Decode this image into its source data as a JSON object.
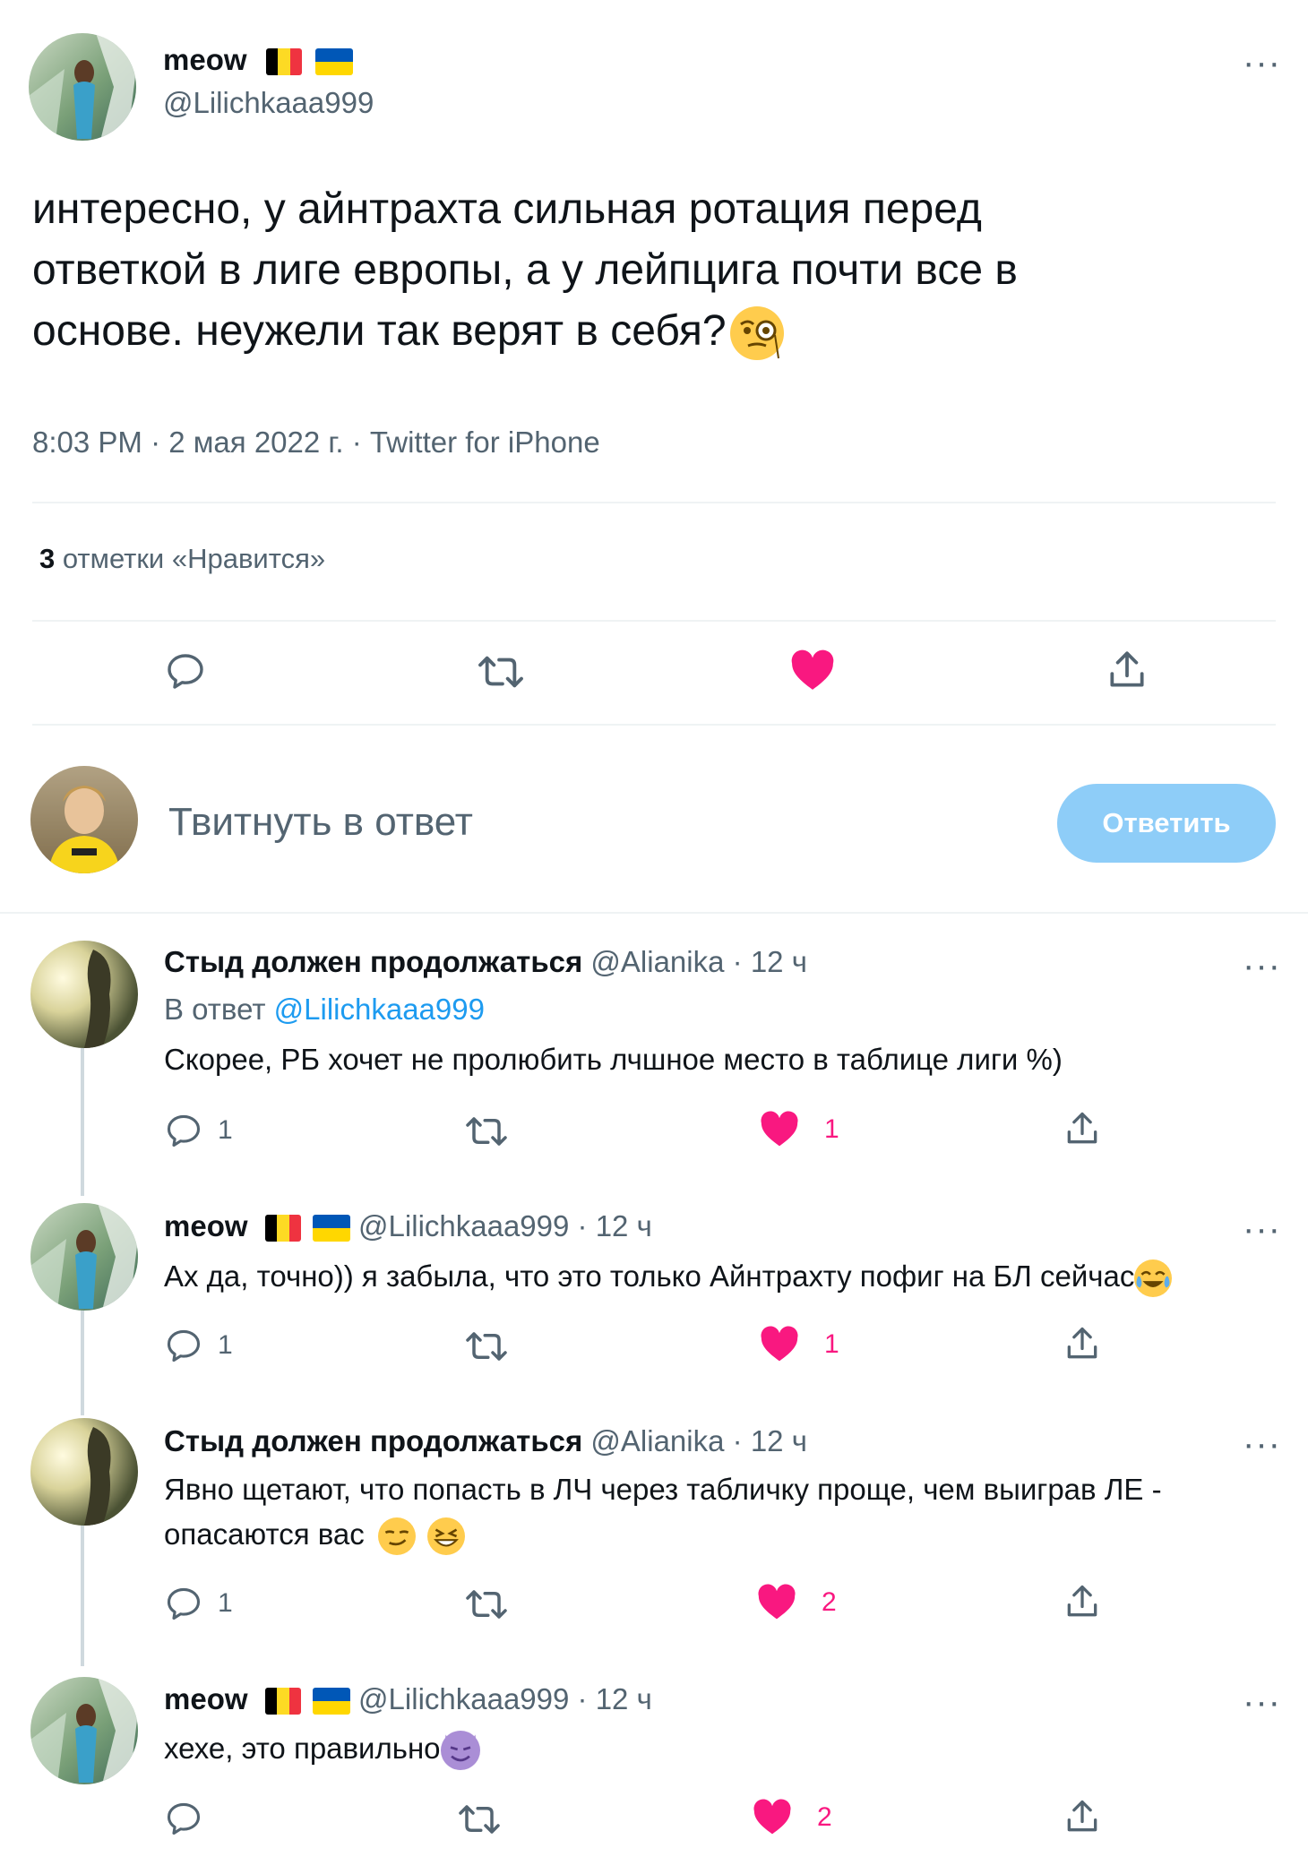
{
  "tweet": {
    "display_name": "meow",
    "handle": "@Lilichkaaa999",
    "text_lines": [
      "интересно, у айнтрахта сильная ротация перед",
      "ответкой в лиге европы, а у лейпцига почти все в",
      "основе. неужели так верят в себя?"
    ],
    "text_emoji": "face-with-monocle",
    "meta": "8:03 PM · 2 мая 2022 г. · Twitter for iPhone",
    "likes_count": "3",
    "likes_label": "отметки «Нравится»"
  },
  "compose": {
    "placeholder": "Твитнуть в ответ",
    "button": "Ответить"
  },
  "replies": [
    {
      "name": "Стыд должен продолжаться",
      "handle": "@Alianika",
      "time": "· 12 ч",
      "reply_to_prefix": "В ответ",
      "reply_to_handle": "@Lilichkaaa999",
      "text": "Скорее, РБ хочет не пролюбить лчшное место в таблице лиги %)",
      "replies": "1",
      "likes": "1",
      "flags": false
    },
    {
      "name": "meow",
      "handle": "@Lilichkaaa999",
      "time": "· 12 ч",
      "text": "Ах да, точно)) я забыла, что это только Айнтрахту пофиг на БЛ сейчас",
      "text_emoji": "face-with-tears-of-joy",
      "replies": "1",
      "likes": "1",
      "flags": true
    },
    {
      "name": "Стыд должен продолжаться",
      "handle": "@Alianika",
      "time": "· 12 ч",
      "text_line1": "Явно щетают, что попасть в ЛЧ через табличку проще, чем выиграв ЛЕ -",
      "text_line2": "опасаются вас",
      "text_emoji": [
        "smirking-face",
        "grinning-squinting-face"
      ],
      "replies": "1",
      "likes": "2",
      "flags": false
    },
    {
      "name": "meow",
      "handle": "@Lilichkaaa999",
      "time": "· 12 ч",
      "text": "хехе, это правильно",
      "text_emoji": "smiling-face-with-horns",
      "replies": "",
      "likes": "2",
      "flags": true
    }
  ],
  "colors": {
    "accent": "#1d9bf0",
    "like": "#f91880",
    "reply_button_disabled": "#8ecdf8",
    "muted": "#536471",
    "flag_belgium": [
      "#000000",
      "#fdda24",
      "#ef3340"
    ],
    "flag_ukraine": [
      "#0057b7",
      "#ffd700"
    ]
  }
}
